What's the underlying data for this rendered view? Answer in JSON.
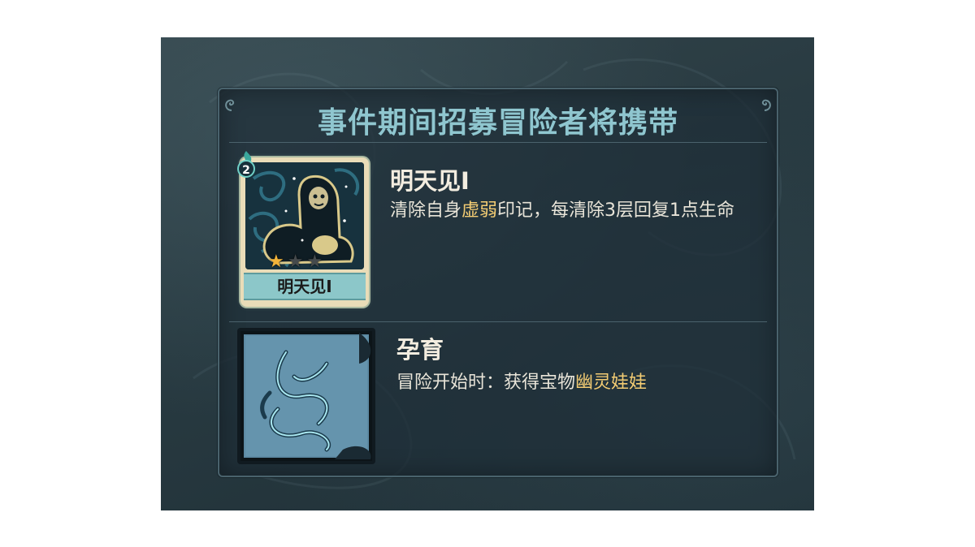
{
  "panel": {
    "title": "事件期间招募冒险者将携带"
  },
  "card": {
    "name": "明天见I",
    "cost": "2",
    "stars_filled": 1,
    "stars_total": 3
  },
  "skills": [
    {
      "name": "明天见I",
      "desc_parts": [
        "清除自身",
        "虚弱",
        "印记，每清除3层回复1点生命"
      ]
    },
    {
      "name": "孕育",
      "desc_parts": [
        "冒险开始时：获得宝物",
        "幽灵娃娃"
      ]
    }
  ],
  "colors": {
    "title": "#8fc6cf",
    "highlight": "#f3cc73",
    "text": "#e8e4d8",
    "panel_border": "#49626c"
  },
  "icons": {
    "card_art": "ghost-creature-icon",
    "relic": "thorn-vine-icon",
    "cost_flame": "teal-flame-icon",
    "corner": "swirl-ornament-icon"
  }
}
